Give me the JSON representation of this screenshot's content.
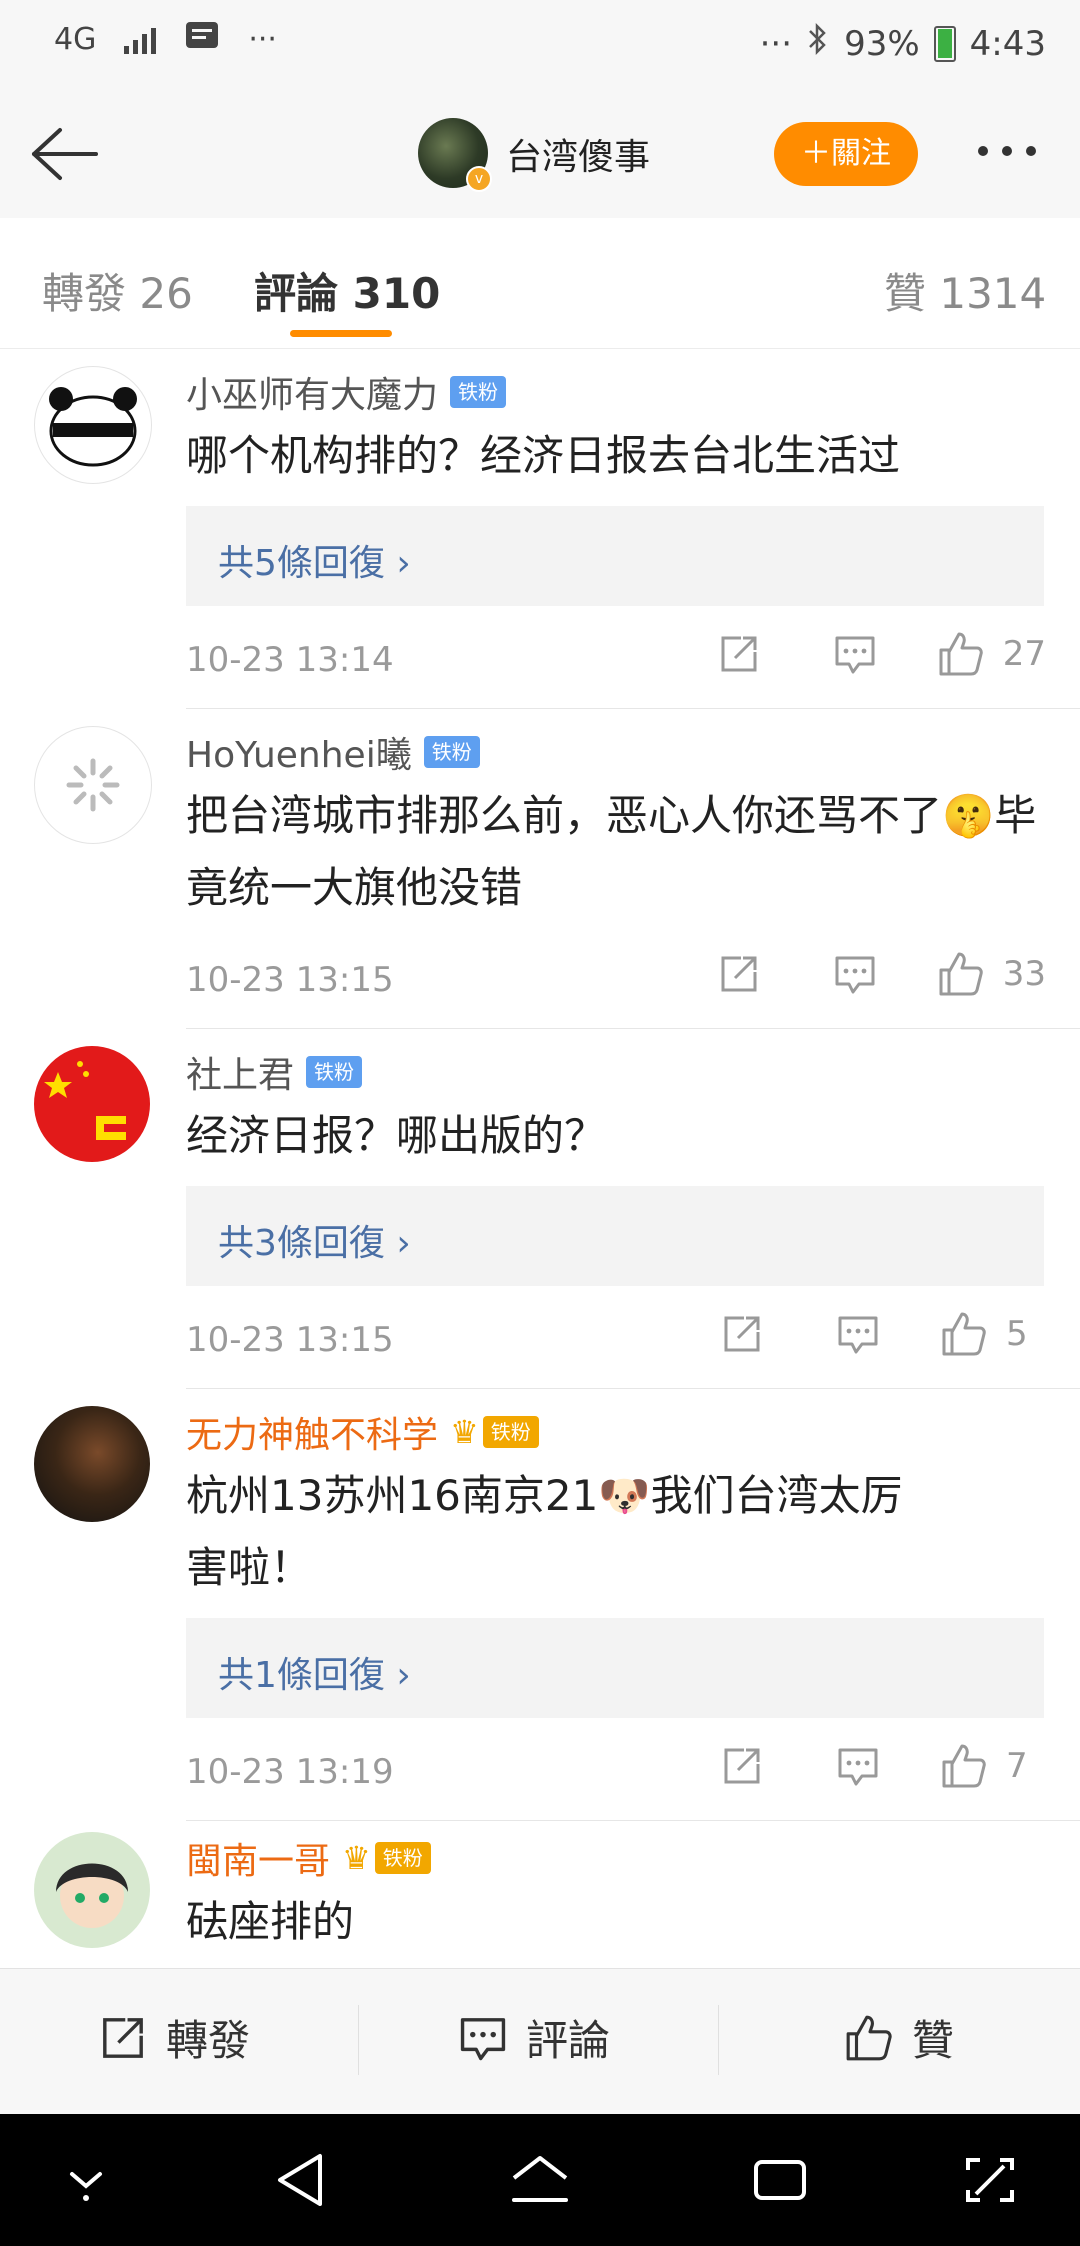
{
  "status_bar": {
    "network": "4G",
    "dots_left": "···",
    "dots_right": "···",
    "battery_pct": "93%",
    "time": "4:43"
  },
  "nav": {
    "title": "台湾傻事",
    "follow_label": "＋關注"
  },
  "tabs": [
    {
      "label": "轉發 26"
    },
    {
      "label": "評論 310"
    },
    {
      "label": "贊 1314"
    }
  ],
  "comments": [
    {
      "name": "小巫师有大魔力",
      "badge": "铁粉",
      "text": "哪个机构排的？经济日报去台北生活过",
      "replies": "共5條回復 ›",
      "time": "10-23 13:14",
      "likes": "27"
    },
    {
      "name": "HoYuenhei曦",
      "badge": "铁粉",
      "text": "把台湾城市排那么前，恶心人你还骂不了🤫毕竟统一大旗他没错",
      "time": "10-23 13:15",
      "likes": "33"
    },
    {
      "name": "社上君",
      "badge": "铁粉",
      "text": "经济日报？哪出版的？",
      "replies": "共3條回復 ›",
      "time": "10-23 13:15",
      "likes": "5"
    },
    {
      "name": "无力神触不科学",
      "badge": "铁粉",
      "text": "杭州13苏州16南京21🐶我们台湾太厉害啦！",
      "replies": "共1條回復 ›",
      "time": "10-23 13:19",
      "likes": "7"
    },
    {
      "name": "閩南一哥",
      "badge": "铁粉",
      "text": "砝座排的"
    }
  ],
  "bottom_bar": {
    "repost": "轉發",
    "comment": "評論",
    "like": "贊"
  },
  "colors": {
    "accent": "#ff8c00",
    "reply_link": "#4a6fa5",
    "vip_name": "#ec6a13",
    "fan_badge": "#5e9ff0"
  }
}
